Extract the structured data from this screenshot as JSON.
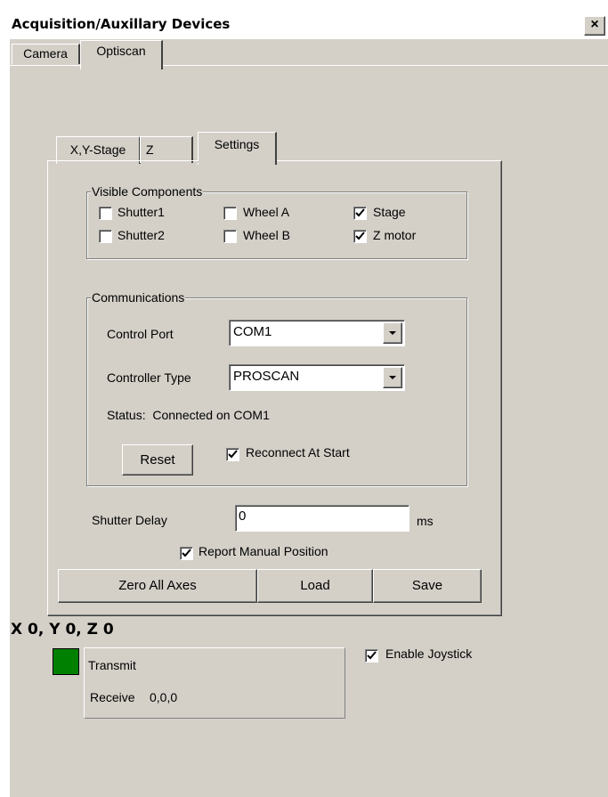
{
  "window": {
    "title": "Acquisition/Auxillary Devices",
    "close_glyph": "×"
  },
  "outer_tabs": [
    {
      "label": "Camera"
    },
    {
      "label": "Optiscan"
    }
  ],
  "inner_tabs": [
    {
      "label": "X,Y-Stage"
    },
    {
      "label": "Z"
    },
    {
      "label": "Settings"
    }
  ],
  "visible_components": {
    "title": "Visible Components",
    "items": [
      {
        "label": "Shutter1",
        "checked": false
      },
      {
        "label": "Wheel A",
        "checked": false
      },
      {
        "label": "Stage",
        "checked": true
      },
      {
        "label": "Shutter2",
        "checked": false
      },
      {
        "label": "Wheel B",
        "checked": false
      },
      {
        "label": "Z motor",
        "checked": true
      }
    ]
  },
  "communications": {
    "title": "Communications",
    "control_port_label": "Control Port",
    "control_port_value": "COM1",
    "controller_type_label": "Controller Type",
    "controller_type_value": "PROSCAN",
    "status_text": "Status:  Connected on COM1",
    "reset_label": "Reset",
    "reconnect_label": "Reconnect At Start",
    "reconnect_checked": true
  },
  "shutter_delay": {
    "label": "Shutter Delay",
    "value": "0",
    "unit": "ms"
  },
  "report_manual_position": {
    "label": "Report Manual Position",
    "checked": true
  },
  "buttons": {
    "zero_all_axes": "Zero All Axes",
    "load": "Load",
    "save": "Save"
  },
  "position_readout": "X 0, Y 0, Z 0",
  "status_indicator_color": "#008000",
  "serial": {
    "transmit_label": "Transmit",
    "receive_label": "Receive",
    "receive_value": "0,0,0"
  },
  "enable_joystick": {
    "label": "Enable Joystick",
    "checked": true
  }
}
